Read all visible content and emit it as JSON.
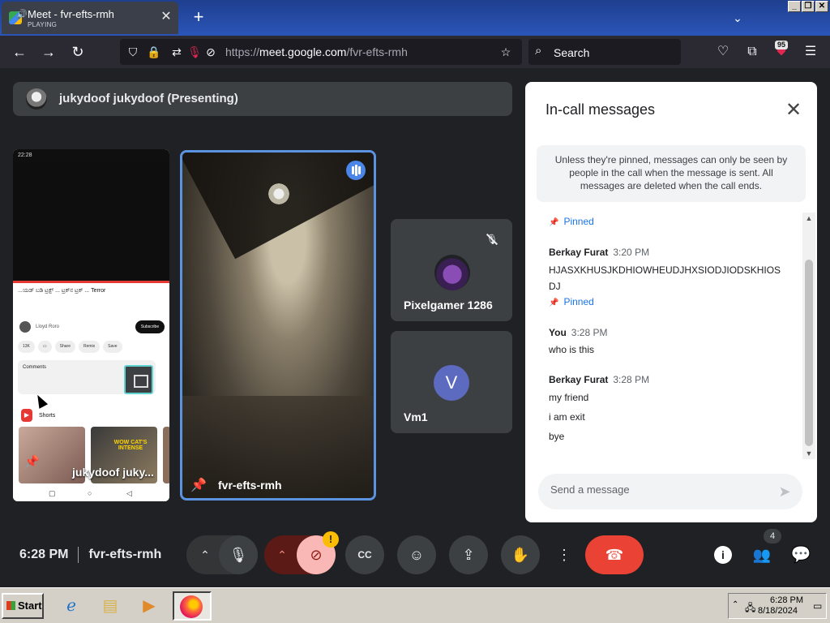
{
  "browser": {
    "tab": {
      "title": "Meet - fvr-efts-rmh",
      "status": "PLAYING",
      "close": "✕"
    },
    "new_tab": "+",
    "tabs_menu": "⌄",
    "window_buttons": [
      "_",
      "❐",
      "✕"
    ],
    "url": {
      "prefix": "https://",
      "host": "meet.google.com",
      "path": "/fvr-efts-rmh"
    },
    "search_placeholder": "Search",
    "extension_badge": "95"
  },
  "meet": {
    "presenter": "jukydoof jukydoof (Presenting)",
    "shared_screen": {
      "status_time": "22:28",
      "video_title": "...ಯಡ್ ಬಡಿ ಟ್ರಕ್ಬ್ ... ಟ್ರಕ್‌ನ ಟ್ರಕ್ ... Terror",
      "channel": "Lloyd Roro",
      "subscribe": "Subscribe",
      "actions": [
        "13K",
        "",
        "Share",
        "Remix",
        "Save"
      ],
      "comments": "Comments",
      "shorts": "Shorts",
      "short_overlay": "WOW CAT'S INTENSE",
      "tile_name": "jukydoof juky..."
    },
    "main_tile_name": "fvr-efts-rmh",
    "participants": [
      {
        "name": "Pixelgamer 1286",
        "muted": true
      },
      {
        "name": "Vm1",
        "initial": "V"
      }
    ]
  },
  "chat": {
    "title": "In-call messages",
    "note": "Unless they're pinned, messages can only be seen by people in the call when the message is sent. All messages are deleted when the call ends.",
    "pinned_label": "Pinned",
    "messages": [
      {
        "sender": "Berkay Furat",
        "time": "3:20 PM",
        "lines": [
          "HJASXKHUSJKDHIOWHEUDJHXSIODJIODSKHIOSDJ"
        ]
      },
      {
        "sender": "You",
        "time": "3:28 PM",
        "lines": [
          "who is this"
        ]
      },
      {
        "sender": "Berkay Furat",
        "time": "3:28 PM",
        "lines": [
          "my friend",
          "i am exit",
          "bye"
        ]
      }
    ],
    "input_placeholder": "Send a message"
  },
  "controls": {
    "time": "6:28 PM",
    "meeting_code": "fvr-efts-rmh",
    "warning": "!",
    "people_count": "4"
  },
  "taskbar": {
    "start": "Start",
    "time": "6:28 PM",
    "date": "8/18/2024"
  }
}
